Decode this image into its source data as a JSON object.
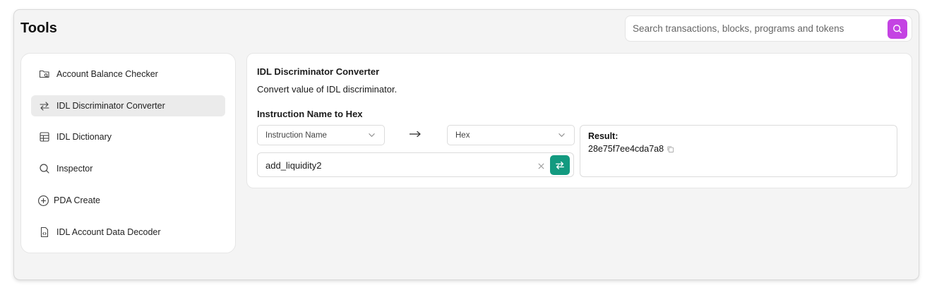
{
  "header": {
    "title": "Tools",
    "search": {
      "placeholder": "Search transactions, blocks, programs and tokens",
      "value": "",
      "button_icon": "search-icon",
      "button_color": "#c443e3"
    }
  },
  "sidebar": {
    "items": [
      {
        "label": "Account Balance Checker",
        "icon": "folder-search-icon",
        "active": false
      },
      {
        "label": "IDL Discriminator Converter",
        "icon": "swap-arrows-icon",
        "active": true
      },
      {
        "label": "IDL Dictionary",
        "icon": "table-icon",
        "active": false
      },
      {
        "label": "Inspector",
        "icon": "search-icon",
        "active": false
      },
      {
        "label": "PDA Create",
        "icon": "plus-circle-icon",
        "active": false
      },
      {
        "label": "IDL Account Data Decoder",
        "icon": "file-code-icon",
        "active": false
      }
    ]
  },
  "main": {
    "title": "IDL Discriminator Converter",
    "description": "Convert value of IDL discriminator.",
    "section_title": "Instruction Name to Hex",
    "from_select": {
      "value": "Instruction Name"
    },
    "to_select": {
      "value": "Hex"
    },
    "input": {
      "value": "add_liquidity2"
    },
    "convert_button_color": "#139a80",
    "result": {
      "label": "Result:",
      "value": "28e75f7ee4cda7a8"
    }
  }
}
